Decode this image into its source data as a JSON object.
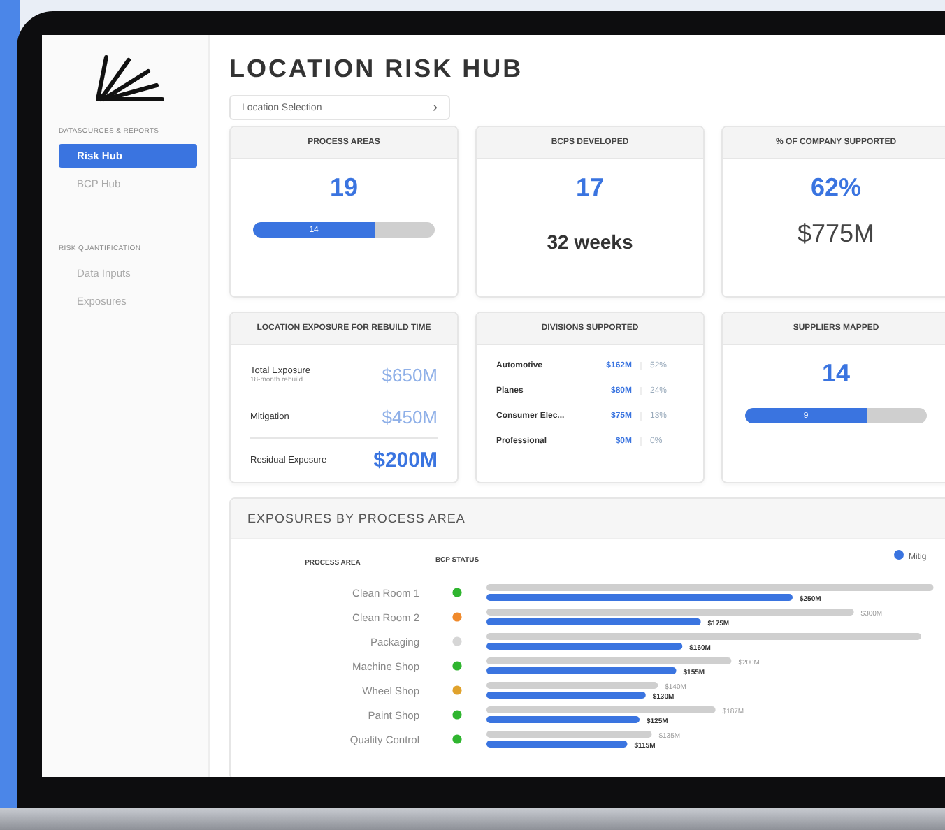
{
  "sidebar": {
    "sections": [
      {
        "heading": "DATASOURCES & REPORTS",
        "items": [
          {
            "label": "Risk Hub",
            "selected": true
          },
          {
            "label": "BCP Hub",
            "selected": false
          }
        ]
      },
      {
        "heading": "RISK QUANTIFICATION",
        "items": [
          {
            "label": "Data Inputs",
            "selected": false
          },
          {
            "label": "Exposures",
            "selected": false
          }
        ]
      }
    ]
  },
  "title": "LOCATION RISK HUB",
  "location_select": {
    "placeholder": "Location Selection",
    "chevron": "›"
  },
  "cards": [
    {
      "kind": "progress",
      "title": "PROCESS AREAS",
      "value": "19",
      "bar_label": "14",
      "level": 0.67
    },
    {
      "kind": "stats",
      "title": "BCPS DEVELOPED",
      "value": "17",
      "secondary": "32 weeks"
    },
    {
      "kind": "money",
      "title": "% OF COMPANY SUPPORTED",
      "value": "62%",
      "secondary": "$775M"
    },
    {
      "kind": "exposure",
      "title": "LOCATION EXPOSURE FOR REBUILD TIME",
      "rows": [
        {
          "label": "Total Exposure",
          "sub": "18-month rebuild",
          "amount": "$650M",
          "emphasis": false
        },
        {
          "label": "Mitigation",
          "amount": "$450M",
          "emphasis": false
        },
        {
          "label": "Residual Exposure",
          "amount": "$200M",
          "emphasis": true
        }
      ]
    },
    {
      "kind": "divisions",
      "title": "DIVISIONS SUPPORTED",
      "rows": [
        {
          "label": "Automotive",
          "amount": "$162M",
          "share": "52%"
        },
        {
          "label": "Planes",
          "amount": "$80M",
          "share": "24%"
        },
        {
          "label": "Consumer Elec...",
          "amount": "$75M",
          "share": "13%"
        },
        {
          "label": "Professional",
          "amount": "$0M",
          "share": "0%"
        }
      ]
    },
    {
      "kind": "progress",
      "title": "SUPPLIERS MAPPED",
      "value": "14",
      "bar_label": "9",
      "level": 0.67
    }
  ],
  "exposures": {
    "title": "EXPOSURES BY PROCESS AREA",
    "column_headers": [
      "PROCESS AREA",
      "BCP STATUS"
    ],
    "status": [
      {
        "color": "#2fb52f"
      },
      {
        "color": "#f08a2c"
      },
      {
        "color": "#d6d6d6"
      },
      {
        "color": "#2fb52f"
      },
      {
        "color": "#e0a22c"
      },
      {
        "color": "#2fb52f"
      },
      {
        "color": "#2fb52f"
      }
    ],
    "chart_data": {
      "type": "bar",
      "orientation": "horizontal",
      "categories": [
        "Clean Room 1",
        "Clean Room 2",
        "Packaging",
        "Machine Shop",
        "Wheel Shop",
        "Paint Shop",
        "Quality Control"
      ],
      "series": [
        {
          "color": "#cfcfcf",
          "values": [
            365,
            300,
            355,
            200,
            140,
            187,
            135
          ],
          "value_labels": [
            null,
            "$300M",
            null,
            "$200M",
            "$140M",
            "$187M",
            "$135M"
          ]
        },
        {
          "name": "Mitig",
          "color": "#3a74e0",
          "values": [
            250,
            175,
            160,
            155,
            130,
            125,
            115
          ],
          "value_labels": [
            "$250M",
            "$175M",
            "$160M",
            "$155M",
            "$130M",
            "$125M",
            "$115M"
          ]
        }
      ]
    }
  }
}
